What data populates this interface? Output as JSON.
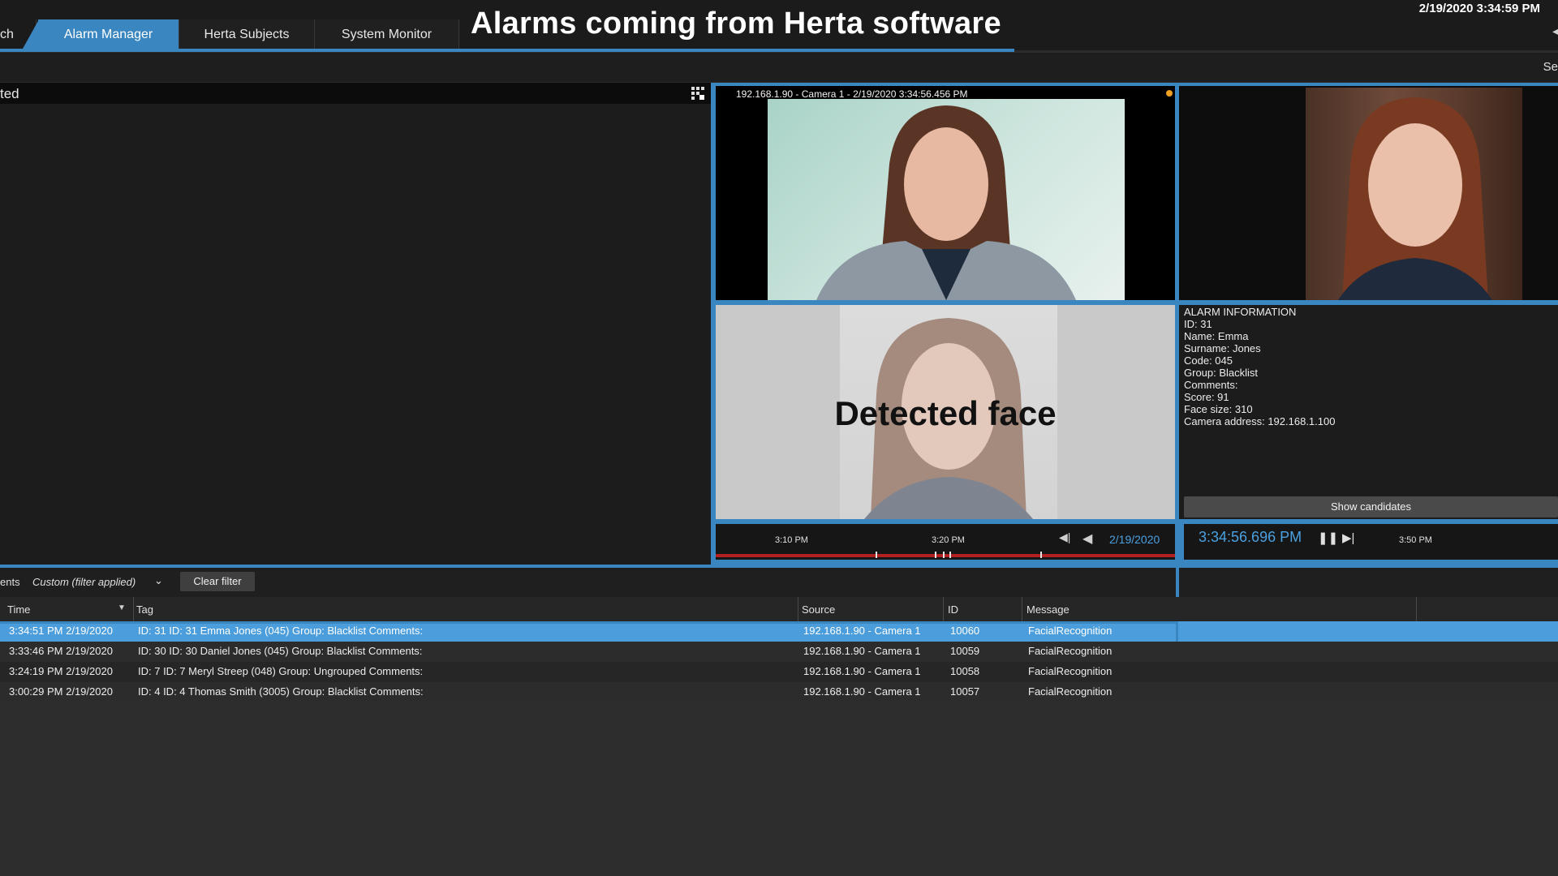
{
  "header": {
    "clock": "2/19/2020 3:34:59 PM",
    "overlay_title": "Alarms coming from Herta software",
    "tabs": [
      {
        "label": "ch"
      },
      {
        "label": "Alarm Manager"
      },
      {
        "label": "Herta Subjects"
      },
      {
        "label": "System Monitor"
      }
    ],
    "toolbar_right": "Se"
  },
  "left_panel": {
    "header_label": "ted"
  },
  "camera_live": {
    "title": "192.168.1.90 - Camera 1 - 2/19/2020 3:34:56.456 PM"
  },
  "detected": {
    "label": "Detected face"
  },
  "alarm_info": {
    "lines": [
      "ALARM INFORMATION",
      "ID: 31",
      "Name: Emma",
      "Surname: Jones",
      "Code: 045",
      "Group: Blacklist",
      "Comments:",
      "Score: 91",
      "Face size: 310",
      "Camera address: 192.168.1.100"
    ],
    "show_candidates": "Show candidates"
  },
  "timeline_left": {
    "ticks": [
      "3:10 PM",
      "3:20 PM"
    ],
    "date": "2/19/2020"
  },
  "timeline_right": {
    "time": "3:34:56.696 PM",
    "tick": "3:50 PM"
  },
  "filter": {
    "label": "ents",
    "value": "Custom (filter applied)",
    "clear_button": "Clear filter"
  },
  "table": {
    "headers": [
      "Time",
      "Tag",
      "Source",
      "ID",
      "Message"
    ],
    "rows": [
      {
        "time": "3:34:51 PM 2/19/2020",
        "tag": "ID: 31 ID: 31 Emma Jones (045) Group: Blacklist Comments:",
        "source": "192.168.1.90 - Camera 1",
        "id": "10060",
        "message": "FacialRecognition"
      },
      {
        "time": "3:33:46 PM 2/19/2020",
        "tag": "ID: 30 ID: 30 Daniel Jones (045) Group: Blacklist Comments:",
        "source": "192.168.1.90 - Camera 1",
        "id": "10059",
        "message": "FacialRecognition"
      },
      {
        "time": "3:24:19 PM 2/19/2020",
        "tag": "ID: 7 ID: 7 Meryl Streep (048) Group: Ungrouped Comments:",
        "source": "192.168.1.90 - Camera 1",
        "id": "10058",
        "message": "FacialRecognition"
      },
      {
        "time": "3:00:29 PM 2/19/2020",
        "tag": "ID: 4 ID: 4 Thomas Smith (3005) Group: Blacklist Comments:",
        "source": "192.168.1.90 - Camera 1",
        "id": "10057",
        "message": "FacialRecognition"
      }
    ]
  },
  "colors": {
    "accent": "#3a86c0",
    "selected_row": "#4b9edb",
    "timeline_marker": "#b22020",
    "live_dot": "#f0a020"
  },
  "icons": [
    "grid-layout-icon",
    "skip-back-icon",
    "step-back-icon",
    "pause-icon",
    "play-icon",
    "chevron-down-icon",
    "sort-down-icon"
  ]
}
